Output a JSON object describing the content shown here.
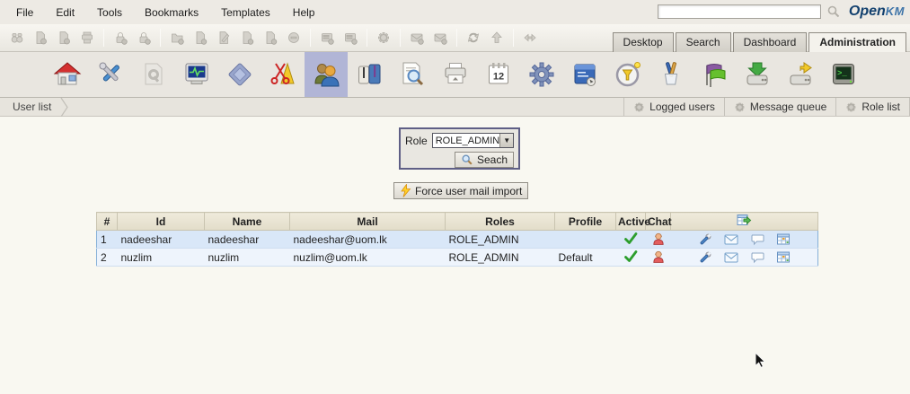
{
  "menubar": {
    "items": [
      "File",
      "Edit",
      "Tools",
      "Bookmarks",
      "Templates",
      "Help"
    ]
  },
  "topbar": {
    "search_value": "",
    "search_icon": "magnifier-icon",
    "logo_part1": "Open",
    "logo_part2": "KM"
  },
  "tabs": {
    "items": [
      {
        "label": "Desktop",
        "active": false
      },
      {
        "label": "Search",
        "active": false
      },
      {
        "label": "Dashboard",
        "active": false
      },
      {
        "label": "Administration",
        "active": true
      }
    ]
  },
  "small_toolbar": {
    "icons": [
      "find-icon",
      "download-document-icon",
      "download-pdf-icon",
      "print-icon",
      "lock-icon",
      "unlock-icon",
      "create-folder-icon",
      "create-document-icon",
      "edit-document-icon",
      "checkin-icon",
      "cancel-checkout-icon",
      "delete-icon",
      "add-property-group-icon",
      "remove-property-group-icon",
      "workflow-gear-icon",
      "add-subscription-icon",
      "remove-subscription-icon",
      "refresh-icon",
      "go-home-icon",
      "toggle-splitter-icon"
    ]
  },
  "big_toolbar": {
    "icons": [
      "home-icon",
      "tools-icon",
      "report-config-icon",
      "system-monitor-icon",
      "plugin-icon",
      "utilities-icon",
      "users-icon",
      "profiles-icon",
      "log-search-icon",
      "printer-icon",
      "crontab-icon",
      "settings-gear-icon",
      "workflow-icon",
      "scheduler-clock-icon",
      "scripting-icon",
      "language-flags-icon",
      "database-import-icon",
      "database-export-icon",
      "console-icon"
    ],
    "active_icon": "users-icon"
  },
  "statusbar": {
    "breadcrumb": "User list",
    "buttons": [
      {
        "label": "Logged users",
        "icon": "gear-icon"
      },
      {
        "label": "Message queue",
        "icon": "gear-icon"
      },
      {
        "label": "Role list",
        "icon": "gear-icon"
      }
    ]
  },
  "search_panel": {
    "role_label": "Role",
    "role_value": "ROLE_ADMIN",
    "search_button_label": "Seach",
    "search_button_icon": "magnifier-icon"
  },
  "actions": {
    "force_mail_import_label": "Force user mail import",
    "force_mail_import_icon": "lightning-icon"
  },
  "user_table": {
    "headers": [
      "#",
      "Id",
      "Name",
      "Mail",
      "Roles",
      "Profile",
      "Active",
      "Chat"
    ],
    "header_action_icon": "export-table-icon",
    "row_action_icons": [
      "edit-user-icon",
      "mail-user-icon",
      "chat-user-icon",
      "user-report-icon"
    ],
    "rows": [
      {
        "num": "1",
        "id": "nadeeshar",
        "name": "nadeeshar",
        "mail": "nadeeshar@uom.lk",
        "roles": "ROLE_ADMIN",
        "profile": "",
        "active": "checked",
        "chat": "enabled"
      },
      {
        "num": "2",
        "id": "nuzlim",
        "name": "nuzlim",
        "mail": "nuzlim@uom.lk",
        "roles": "ROLE_ADMIN",
        "profile": "Default",
        "active": "checked",
        "chat": "enabled"
      }
    ]
  },
  "colors": {
    "selected_tool_bg": "#b1b5d6",
    "selected_row_bg": "#d9e7f8",
    "table_header_bg": "#e9e4d2",
    "table_border": "#86b0d8",
    "check_green": "#2d9e2d",
    "logo_navy": "#12406e",
    "logo_blue": "#3e74a8"
  }
}
